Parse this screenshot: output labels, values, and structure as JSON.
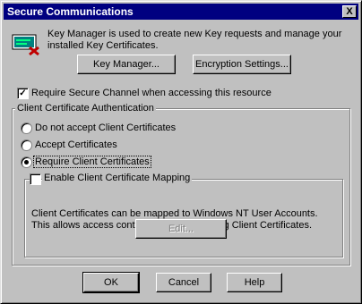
{
  "window": {
    "title": "Secure Communications",
    "close_label": "X"
  },
  "intro_text": "Key Manager is used to create new Key requests and manage your installed Key Certificates.",
  "buttons": {
    "key_manager": "Key Manager...",
    "encryption_settings": "Encryption Settings...",
    "edit": "Edit...",
    "ok": "OK",
    "cancel": "Cancel",
    "help": "Help"
  },
  "require_secure_channel": {
    "label": "Require Secure Channel when accessing this resource",
    "checked": true
  },
  "client_cert_auth": {
    "legend": "Client Certificate Authentication",
    "options": [
      {
        "label": "Do not accept Client Certificates",
        "selected": false
      },
      {
        "label": "Accept Certificates",
        "selected": false
      },
      {
        "label": "Require Client Certificates",
        "selected": true
      }
    ]
  },
  "mapping": {
    "label": "Enable Client Certificate Mapping",
    "checked": false,
    "description": "Client Certificates can be mapped to Windows NT User Accounts.  This allows access control to resources using Client Certificates."
  }
}
